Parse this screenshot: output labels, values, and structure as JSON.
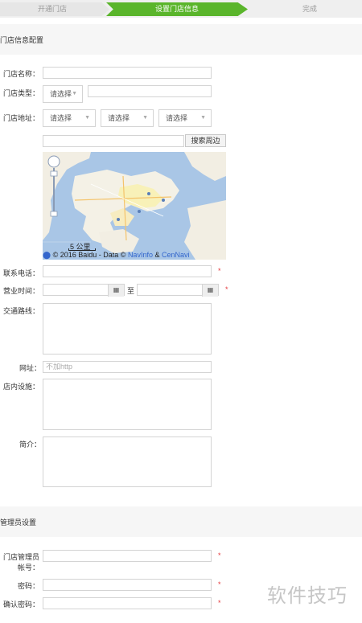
{
  "steps": {
    "step1": "开通门店",
    "step2": "设置门店信息",
    "step3": "完成"
  },
  "store_section": {
    "title": "门店信息配置",
    "name_label": "门店名称：",
    "type_label": "门店类型：",
    "type_select": "请选择",
    "address_label": "门店地址：",
    "province_select": "请选择",
    "city_select": "请选择",
    "district_select": "请选择",
    "search_button": "搜索周边",
    "map_scale": "5 公里",
    "map_copyright_prefix": "© 2016 Baidu - Data ©",
    "map_copyright_navinfo": "NavInfo",
    "map_copyright_amp": "&",
    "map_copyright_cennavi": "CenNavi",
    "phone_label": "联系电话：",
    "hours_label": "营业时间：",
    "hours_to": "至",
    "route_label": "交通路线：",
    "website_label": "网址：",
    "website_placeholder": "不加http",
    "facilities_label": "店内设施：",
    "intro_label": "简介："
  },
  "admin_section": {
    "title": "管理员设置",
    "account_label_line1": "门店管理员",
    "account_label_line2": "帐号：",
    "password_label": "密码：",
    "confirm_label": "确认密码："
  },
  "required_mark": "*",
  "watermark": "软件技巧",
  "colors": {
    "active_step": "#5ab52b",
    "required": "#e4393c",
    "link": "#3366cc"
  }
}
